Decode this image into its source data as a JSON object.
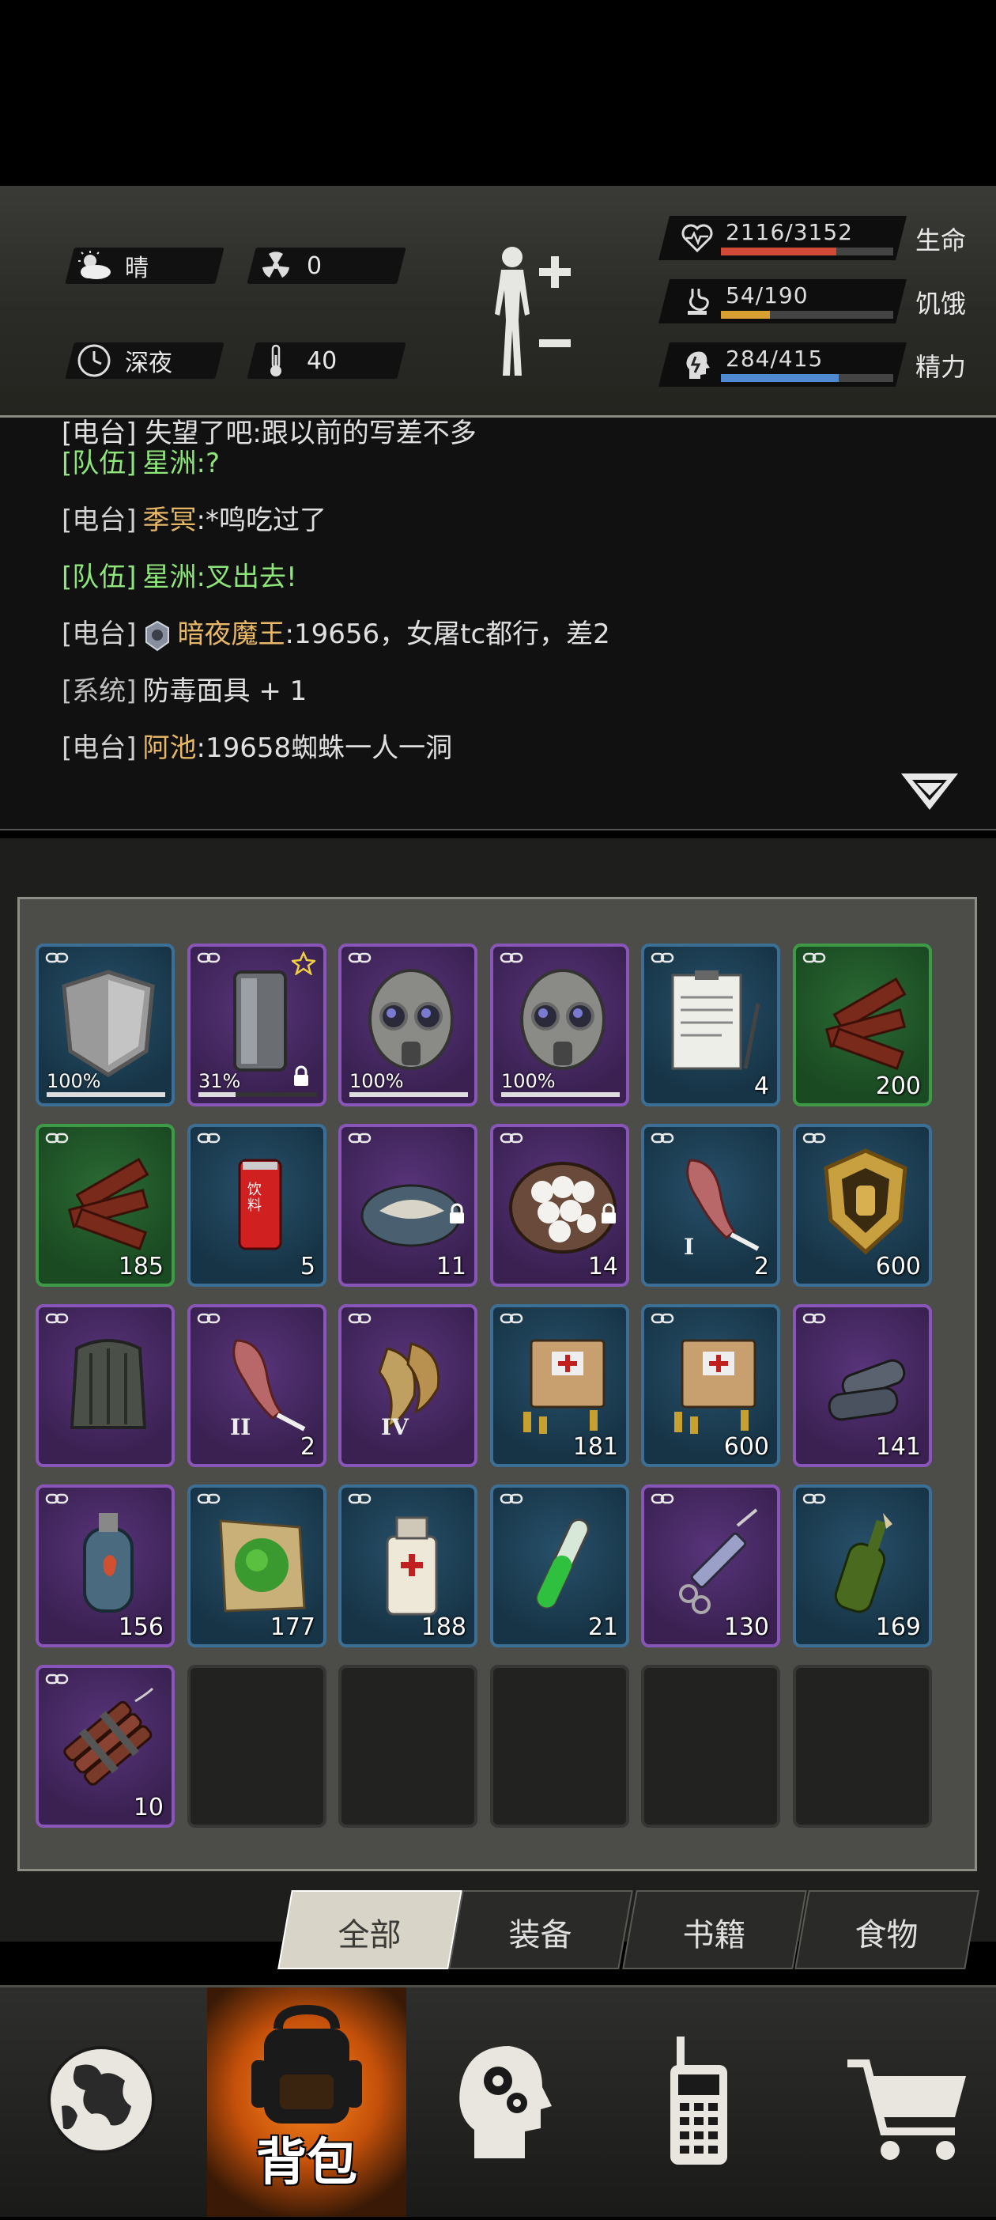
{
  "status": {
    "weather": "晴",
    "radiation": "0",
    "time_of_day": "深夜",
    "temperature": "40",
    "health": {
      "value": "2116/3152",
      "label": "生命",
      "fraction": 0.671,
      "color": "#d04a36"
    },
    "hunger": {
      "value": "54/190",
      "label": "饥饿",
      "fraction": 0.284,
      "color": "#d8a030"
    },
    "energy": {
      "value": "284/415",
      "label": "精力",
      "fraction": 0.684,
      "color": "#4f8ad0"
    }
  },
  "chat": {
    "partial_top": "[电台] 失望了吧:跟以前的写差不多",
    "lines": [
      {
        "tag": "[队伍]",
        "name": "星洲",
        "msg": ":?"
      },
      {
        "tag": "[电台]",
        "name": "季冥",
        "msg": ":*鸣吃过了"
      },
      {
        "tag": "[队伍]",
        "name": "星洲",
        "msg": ":叉出去!"
      },
      {
        "tag": "[电台]",
        "name": "暗夜魔王",
        "msg": ":19656，女屠tc都行，差2"
      },
      {
        "tag": "[系统]",
        "name": "",
        "msg": "防毒面具 + 1"
      },
      {
        "tag": "[电台]",
        "name": "阿池",
        "msg": ":19658蜘蛛一人一洞"
      }
    ]
  },
  "inventory": {
    "items": [
      {
        "name": "shield",
        "rarity": "blue",
        "percent": "100%",
        "durability": 1.0
      },
      {
        "name": "riot-shield",
        "rarity": "purple",
        "percent": "31%",
        "durability": 0.31,
        "starred": true,
        "locked": true
      },
      {
        "name": "gas-mask",
        "rarity": "purple",
        "percent": "100%",
        "durability": 1.0
      },
      {
        "name": "gas-mask",
        "rarity": "purple",
        "percent": "100%",
        "durability": 1.0
      },
      {
        "name": "clipboard-document",
        "rarity": "blue",
        "count": "4"
      },
      {
        "name": "jerky",
        "rarity": "green",
        "count": "200"
      },
      {
        "name": "jerky",
        "rarity": "green",
        "count": "185"
      },
      {
        "name": "soda-can",
        "rarity": "blue",
        "count": "5",
        "can_text": "饮料"
      },
      {
        "name": "fish-plate",
        "rarity": "purple",
        "count": "11",
        "locked": true
      },
      {
        "name": "dumpling-bowl",
        "rarity": "purple",
        "count": "14",
        "locked": true
      },
      {
        "name": "meat-leg",
        "rarity": "blue",
        "count": "2",
        "tier": "I"
      },
      {
        "name": "gold-badge",
        "rarity": "blue",
        "count": "600"
      },
      {
        "name": "armor-vest",
        "rarity": "purple"
      },
      {
        "name": "meat-leg",
        "rarity": "purple",
        "count": "2",
        "tier": "II"
      },
      {
        "name": "wings",
        "rarity": "purple",
        "tier": "IV"
      },
      {
        "name": "ammo-box",
        "rarity": "blue",
        "count": "181"
      },
      {
        "name": "ammo-box",
        "rarity": "blue",
        "count": "600"
      },
      {
        "name": "bullets",
        "rarity": "purple",
        "count": "141"
      },
      {
        "name": "gas-canister",
        "rarity": "purple",
        "count": "156"
      },
      {
        "name": "herb-paper",
        "rarity": "blue",
        "count": "177"
      },
      {
        "name": "medicine-bottle",
        "rarity": "blue",
        "count": "188"
      },
      {
        "name": "test-tube",
        "rarity": "blue",
        "count": "21"
      },
      {
        "name": "syringe",
        "rarity": "purple",
        "count": "130"
      },
      {
        "name": "molotov",
        "rarity": "blue",
        "count": "169"
      },
      {
        "name": "dynamite",
        "rarity": "purple",
        "count": "10"
      }
    ],
    "total_slots": 30
  },
  "tabs": [
    "全部",
    "装备",
    "书籍",
    "食物"
  ],
  "active_tab": 0,
  "nav": {
    "backpack_label": "背包"
  }
}
